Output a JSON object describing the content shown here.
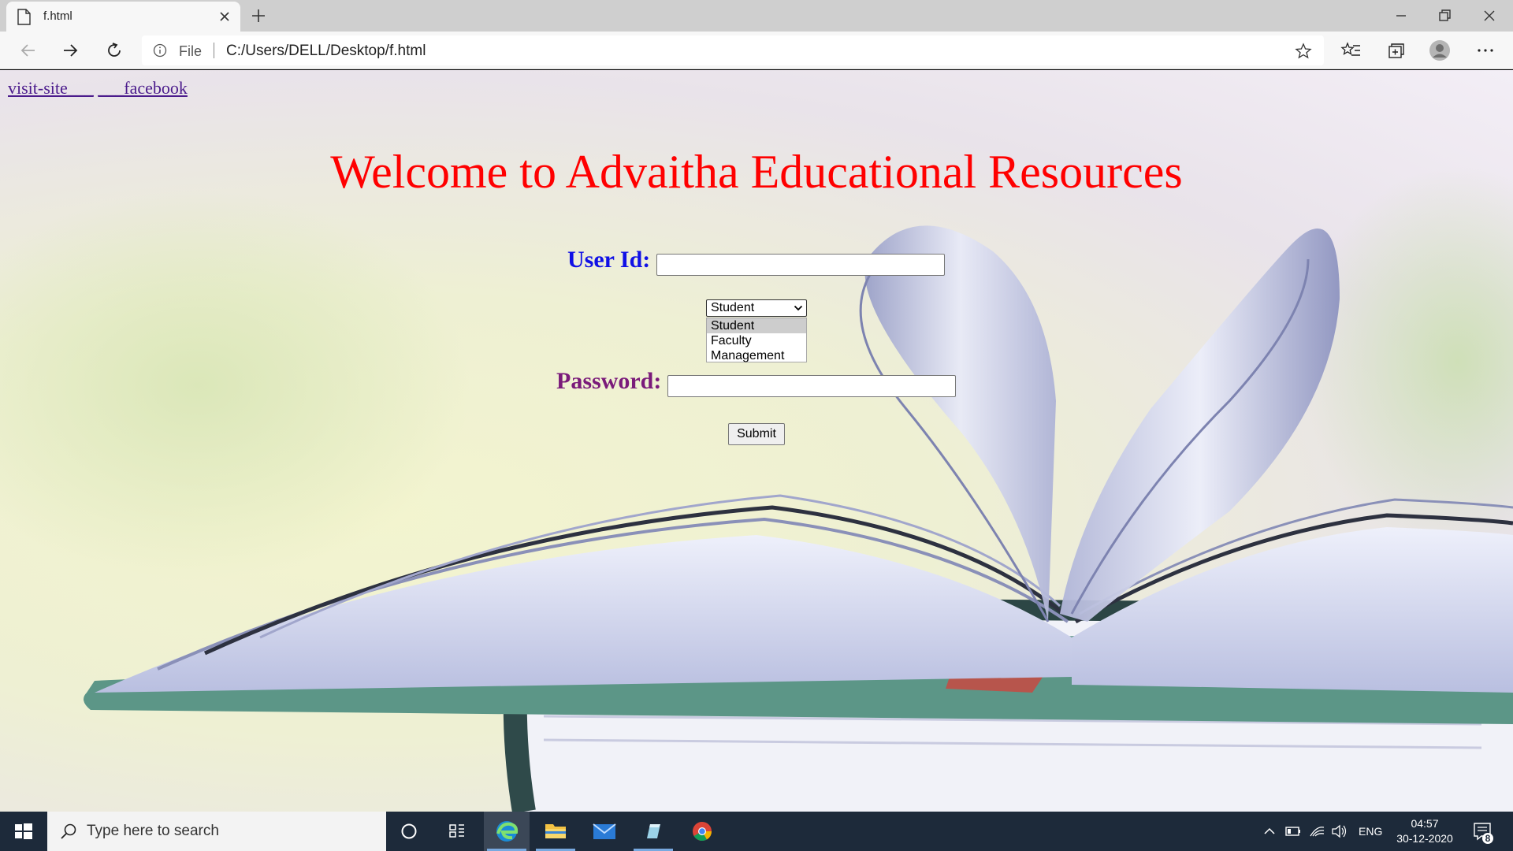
{
  "browser": {
    "tab_title": "f.html",
    "scheme_label": "File",
    "url": "C:/Users/DELL/Desktop/f.html"
  },
  "page": {
    "links": [
      {
        "label": "visit-site___"
      },
      {
        "label": "___facebook"
      }
    ],
    "heading": "Welcome to Advaitha Educational Resources",
    "userid_label": "User Id:",
    "userid_value": "",
    "role_select": {
      "selected": "Student",
      "options": [
        "Student",
        "Faculty",
        "Management"
      ]
    },
    "password_label": "Password:",
    "password_value": "",
    "submit_label": "Submit",
    "colors": {
      "heading": "#ff0000",
      "userid_label": "#1010e6",
      "password_label": "#7a1a7a",
      "link": "#4b1b8c"
    }
  },
  "taskbar": {
    "search_placeholder": "Type here to search",
    "language": "ENG",
    "time": "04:57",
    "date": "30-12-2020",
    "notification_count": "8"
  }
}
